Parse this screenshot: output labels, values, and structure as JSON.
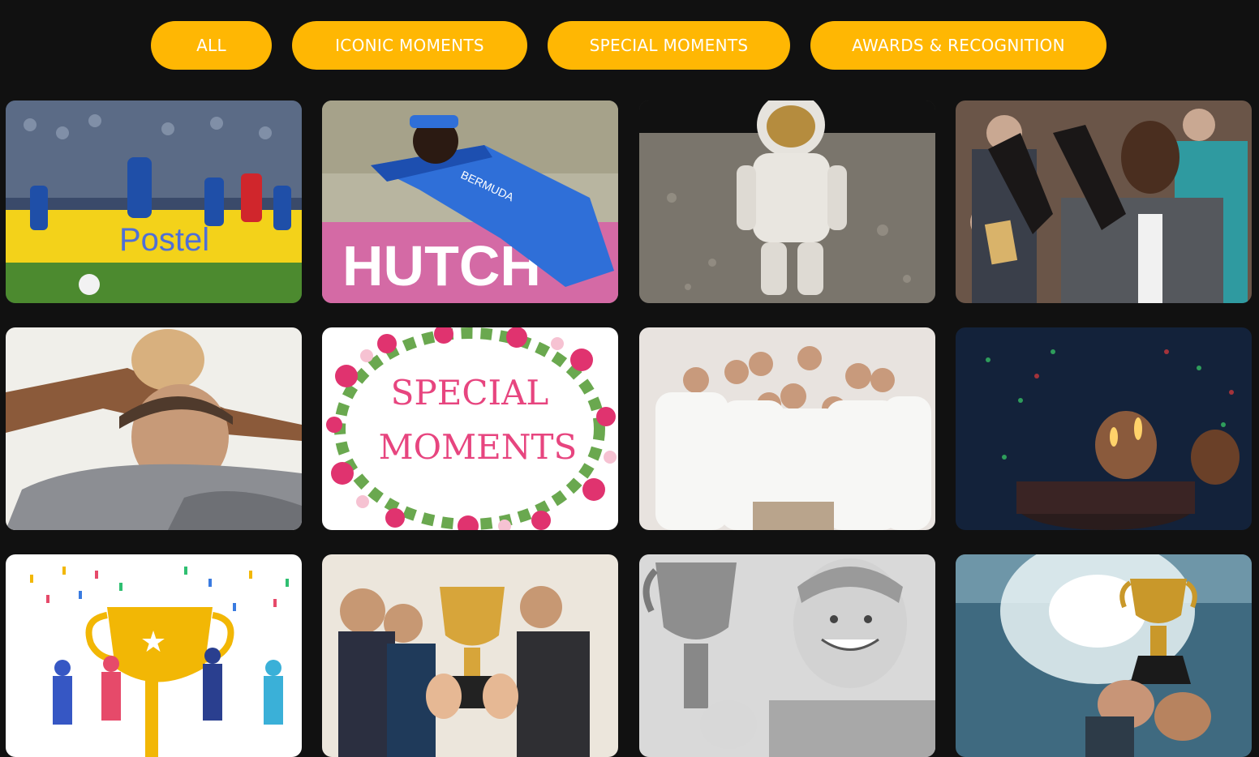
{
  "filters": [
    {
      "label": "ALL"
    },
    {
      "label": "ICONIC MOMENTS"
    },
    {
      "label": "SPECIAL MOMENTS"
    },
    {
      "label": "AWARDS & RECOGNITION"
    }
  ],
  "accent_color": "#ffb703",
  "background_color": "#111111",
  "gallery": [
    {
      "category": "ICONIC MOMENTS",
      "subject": "soccer-players",
      "sign_text": "Postel"
    },
    {
      "category": "ICONIC MOMENTS",
      "subject": "cricket-diving-catch",
      "jersey_text": "BERMUDA",
      "board_text": "HUTCH"
    },
    {
      "category": "ICONIC MOMENTS",
      "subject": "astronaut-on-moon"
    },
    {
      "category": "ICONIC MOMENTS",
      "subject": "man-in-courtroom-gloves"
    },
    {
      "category": "SPECIAL MOMENTS",
      "subject": "father-piggyback-son"
    },
    {
      "category": "SPECIAL MOMENTS",
      "subject": "floral-wreath",
      "line1": "SPECIAL",
      "line2": "MOMENTS"
    },
    {
      "category": "SPECIAL MOMENTS",
      "subject": "family-group-portrait"
    },
    {
      "category": "SPECIAL MOMENTS",
      "subject": "child-birthday-cake"
    },
    {
      "category": "AWARDS & RECOGNITION",
      "subject": "trophy-celebration-illustration"
    },
    {
      "category": "AWARDS & RECOGNITION",
      "subject": "team-holding-trophy"
    },
    {
      "category": "AWARDS & RECOGNITION",
      "subject": "boy-with-trophy"
    },
    {
      "category": "AWARDS & RECOGNITION",
      "subject": "raised-trophy"
    }
  ]
}
